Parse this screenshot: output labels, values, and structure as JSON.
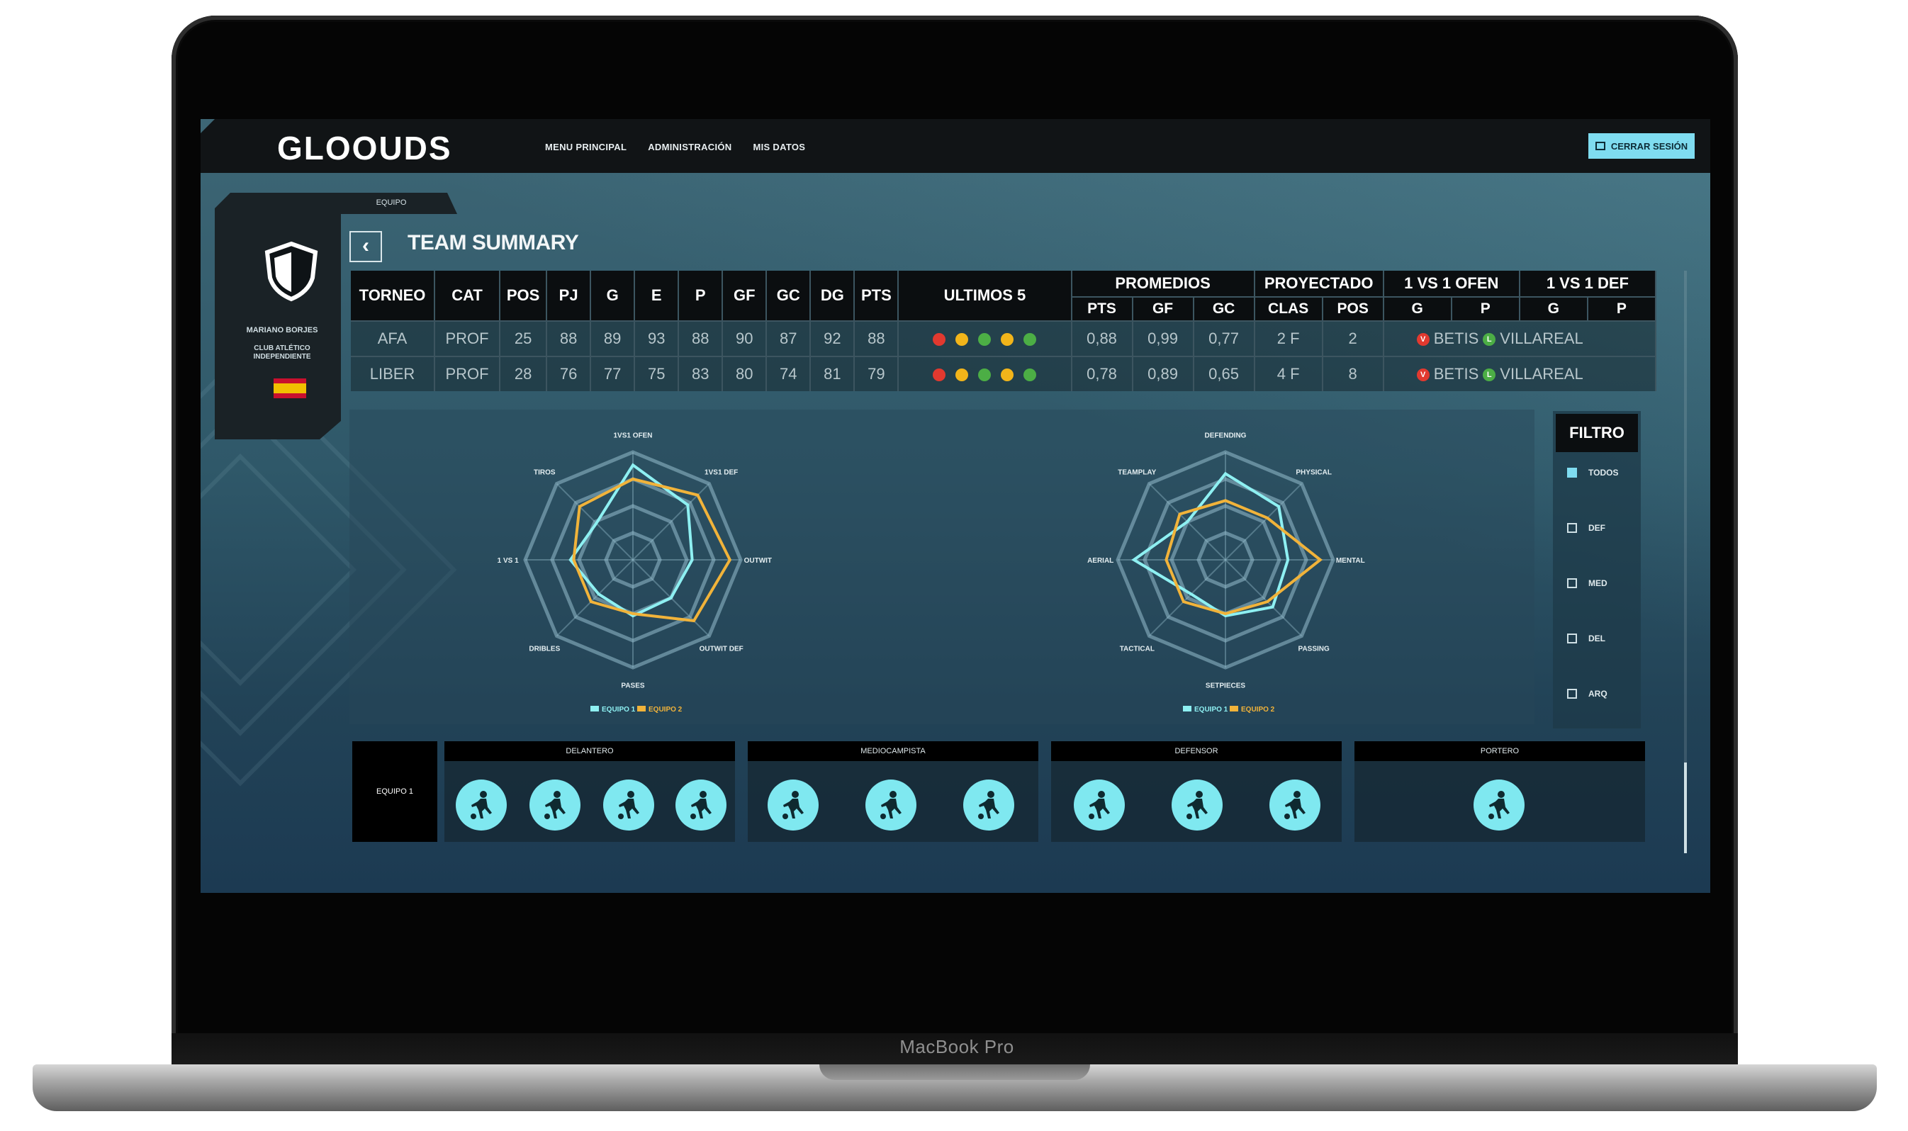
{
  "laptop": {
    "brand": "MacBook Pro"
  },
  "app": {
    "logo": "GLOOUDS",
    "nav": [
      "MENU PRINCIPAL",
      "ADMINISTRACIÓN",
      "MIS DATOS"
    ],
    "logout_label": "CERRAR SESIÓN"
  },
  "team_card": {
    "tab_label": "EQUIPO",
    "coach": "MARIANO BORJES",
    "club": "CLUB ATLÉTICO INDEPENDIENTE"
  },
  "page": {
    "title": "TEAM SUMMARY"
  },
  "table": {
    "group_headers": [
      "PROMEDIOS",
      "PROYECTADO",
      "1 VS 1 OFEN",
      "1 VS 1 DEF"
    ],
    "headers": [
      "TORNEO",
      "CAT",
      "POS",
      "PJ",
      "G",
      "E",
      "P",
      "GF",
      "GC",
      "DG",
      "PTS",
      "ULTIMOS 5"
    ],
    "sub_headers": [
      "PTS",
      "GF",
      "GC",
      "CLAS",
      "POS",
      "G",
      "P",
      "G",
      "P"
    ],
    "rows": [
      {
        "torneo": "AFA",
        "cat": "PROF",
        "pos": "25",
        "pj": "88",
        "g": "89",
        "e": "93",
        "p": "88",
        "gf": "90",
        "gc": "87",
        "dg": "92",
        "pts": "88",
        "ultimos": [
          "#e2392f",
          "#f2b51a",
          "#4cae45",
          "#f2b51a",
          "#4cae45"
        ],
        "prom_pts": "0,88",
        "prom_gf": "0,99",
        "prom_gc": "0,77",
        "clas": "2 F",
        "proy_pos": "2",
        "ofen_tag": "V",
        "ofen_team": "BETIS",
        "def_tag": "L",
        "def_team": "VILLAREAL"
      },
      {
        "torneo": "LIBER",
        "cat": "PROF",
        "pos": "28",
        "pj": "76",
        "g": "77",
        "e": "75",
        "p": "83",
        "gf": "80",
        "gc": "74",
        "dg": "81",
        "pts": "79",
        "ultimos": [
          "#e2392f",
          "#f2b51a",
          "#4cae45",
          "#f2b51a",
          "#4cae45"
        ],
        "prom_pts": "0,78",
        "prom_gf": "0,89",
        "prom_gc": "0,65",
        "clas": "4 F",
        "proy_pos": "8",
        "ofen_tag": "V",
        "ofen_team": "BETIS",
        "def_tag": "L",
        "def_team": "VILLAREAL"
      }
    ]
  },
  "radars": [
    {
      "axes": [
        "1VS1 OFEN",
        "1VS1 DEF",
        "OUTWIT",
        "OUTWIT DEF",
        "PASES",
        "DRIBLES",
        "1 VS 1",
        "TIROS"
      ],
      "legend": [
        "EQUIPO 1",
        "EQUIPO 2"
      ],
      "colors": [
        "#8ef0f2",
        "#f1b33a"
      ],
      "series": [
        {
          "values": [
            0.88,
            0.72,
            0.55,
            0.5,
            0.52,
            0.45,
            0.58,
            0.48
          ]
        },
        {
          "values": [
            0.75,
            0.85,
            0.9,
            0.8,
            0.5,
            0.55,
            0.55,
            0.7
          ]
        }
      ]
    },
    {
      "axes": [
        "DEFENDING",
        "PHYSICAL",
        "MENTAL",
        "PASSING",
        "SETPIECES",
        "TACTICAL",
        "AERIAL",
        "TEAMPLAY"
      ],
      "legend": [
        "EQUIPO 1",
        "EQUIPO 2"
      ],
      "colors": [
        "#8ef0f2",
        "#f1b33a"
      ],
      "series": [
        {
          "values": [
            0.8,
            0.7,
            0.58,
            0.62,
            0.52,
            0.45,
            0.85,
            0.5
          ]
        },
        {
          "values": [
            0.55,
            0.55,
            0.88,
            0.55,
            0.5,
            0.55,
            0.55,
            0.6
          ]
        }
      ]
    }
  ],
  "filter": {
    "title": "FILTRO",
    "options": [
      {
        "label": "TODOS",
        "checked": true
      },
      {
        "label": "DEF",
        "checked": false
      },
      {
        "label": "MED",
        "checked": false
      },
      {
        "label": "DEL",
        "checked": false
      },
      {
        "label": "ARQ",
        "checked": false
      }
    ]
  },
  "lineup": {
    "label": "EQUIPO 1",
    "groups": [
      {
        "name": "DELANTERO",
        "players": 4
      },
      {
        "name": "MEDIOCAMPISTA",
        "players": 3
      },
      {
        "name": "DEFENSOR",
        "players": 3
      },
      {
        "name": "PORTERO",
        "players": 1
      }
    ]
  }
}
